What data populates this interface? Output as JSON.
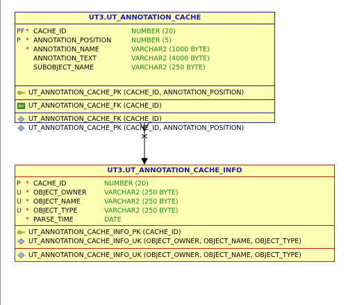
{
  "cache_table": {
    "title": "UT3.UT_ANNOTATION_CACHE",
    "columns": [
      {
        "flag": "PF",
        "req": "*",
        "name": "CACHE_ID",
        "type": "NUMBER (20)"
      },
      {
        "flag": "P",
        "req": "*",
        "name": "ANNOTATION_POSITION",
        "type": "NUMBER (5)"
      },
      {
        "flag": "",
        "req": "*",
        "name": "ANNOTATION_NAME",
        "type": "VARCHAR2 (1000 BYTE)"
      },
      {
        "flag": "",
        "req": "",
        "name": "ANNOTATION_TEXT",
        "type": "VARCHAR2 (4000 BYTE)"
      },
      {
        "flag": "",
        "req": "",
        "name": "SUBOBJECT_NAME",
        "type": "VARCHAR2 (250 BYTE)"
      }
    ],
    "primary_keys": [
      "UT_ANNOTATION_CACHE_PK (CACHE_ID, ANNOTATION_POSITION)"
    ],
    "foreign_keys": [
      "UT_ANNOTATION_CACHE_FK (CACHE_ID)"
    ],
    "indexes": [
      "UT_ANNOTATION_CACHE_FK (CACHE_ID)",
      "UT_ANNOTATION_CACHE_PK (CACHE_ID, ANNOTATION_POSITION)"
    ]
  },
  "info_table": {
    "title": "UT3.UT_ANNOTATION_CACHE_INFO",
    "columns": [
      {
        "flag": "P",
        "req": "*",
        "name": "CACHE_ID",
        "type": "NUMBER (20)"
      },
      {
        "flag": "U",
        "req": "*",
        "name": "OBJECT_OWNER",
        "type": "VARCHAR2 (250 BYTE)"
      },
      {
        "flag": "U",
        "req": "*",
        "name": "OBJECT_NAME",
        "type": "VARCHAR2 (250 BYTE)"
      },
      {
        "flag": "U",
        "req": "*",
        "name": "OBJECT_TYPE",
        "type": "VARCHAR2 (250 BYTE)"
      },
      {
        "flag": "",
        "req": "*",
        "name": "PARSE_TIME",
        "type": "DATE"
      }
    ],
    "keys": [
      {
        "icon": "key-icon",
        "text": "UT_ANNOTATION_CACHE_INFO_PK (CACHE_ID)"
      },
      {
        "icon": "diamond-icon",
        "text": "UT_ANNOTATION_CACHE_INFO_UK (OBJECT_OWNER, OBJECT_NAME, OBJECT_TYPE)"
      }
    ],
    "indexes": [
      "UT_ANNOTATION_CACHE_INFO_UK (OBJECT_OWNER, OBJECT_NAME, OBJECT_TYPE)"
    ]
  },
  "colors": {
    "entity_fill": "#ffffb4",
    "cache_border": "#1e1ea0",
    "info_border": "#b01818",
    "title_text": "#1818b8",
    "type_text": "#1a8a1a",
    "required_marker": "#d40000"
  }
}
